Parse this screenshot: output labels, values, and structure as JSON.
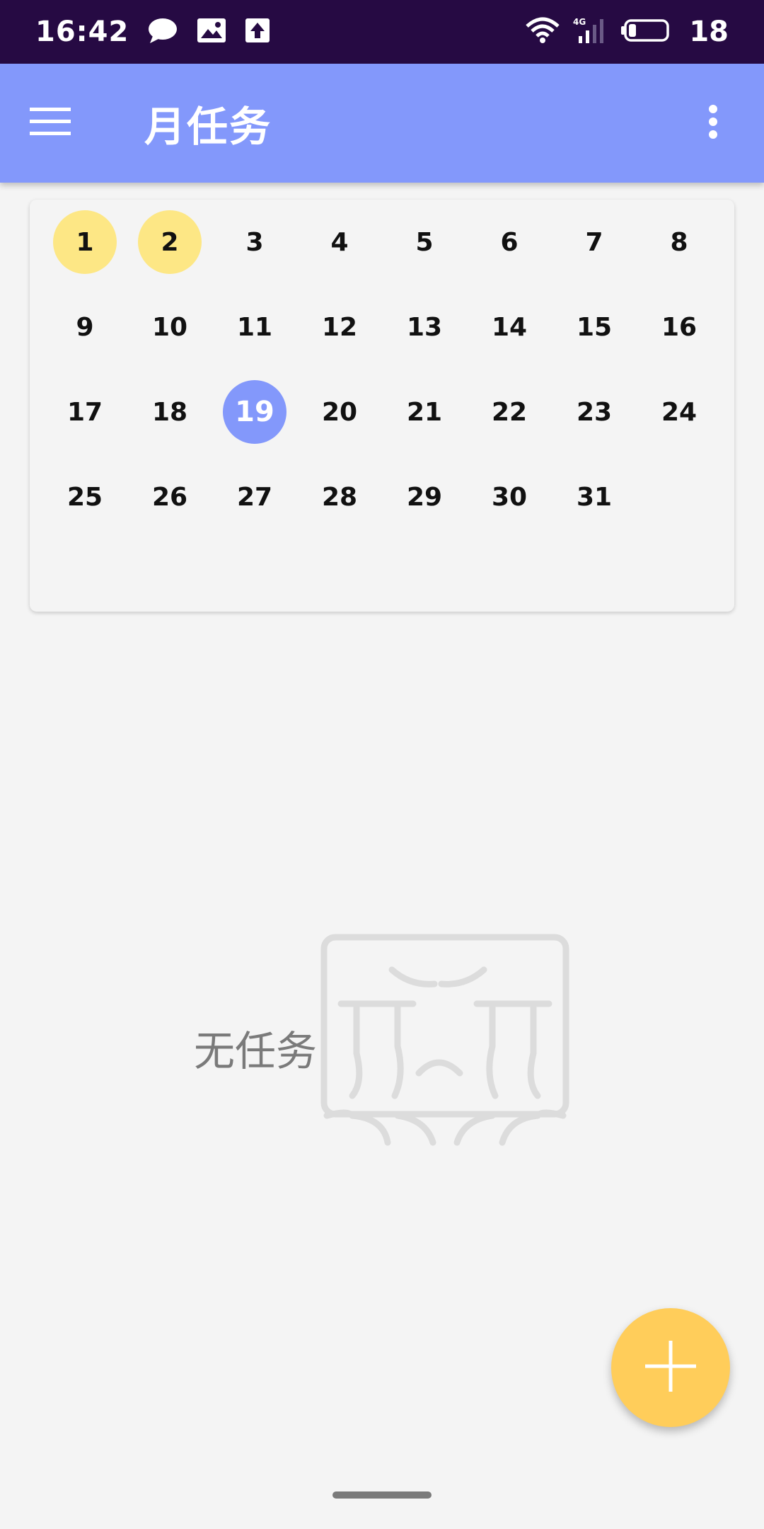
{
  "status_bar": {
    "time": "16:42",
    "icons": [
      "chat-bubble-icon",
      "image-icon",
      "upload-icon",
      "wifi-icon",
      "signal-4g-icon",
      "battery-icon"
    ],
    "battery_level": "18"
  },
  "app_bar": {
    "title": "月任务",
    "menu_icon": "hamburger-menu-icon",
    "more_icon": "more-vert-icon"
  },
  "calendar": {
    "days": [
      1,
      2,
      3,
      4,
      5,
      6,
      7,
      8,
      9,
      10,
      11,
      12,
      13,
      14,
      15,
      16,
      17,
      18,
      19,
      20,
      21,
      22,
      23,
      24,
      25,
      26,
      27,
      28,
      29,
      30,
      31
    ],
    "today": 19,
    "marked_days": [
      1,
      2
    ],
    "colors": {
      "marked": "#fde785",
      "today": "#8398fb"
    }
  },
  "empty_state": {
    "label": "无任务",
    "illustration_icon": "crying-face-icon"
  },
  "fab": {
    "icon": "plus-icon",
    "color": "#ffcd5a"
  },
  "colors": {
    "status_bar": "#260a43",
    "app_bar": "#8398fb",
    "background": "#f4f4f4"
  }
}
